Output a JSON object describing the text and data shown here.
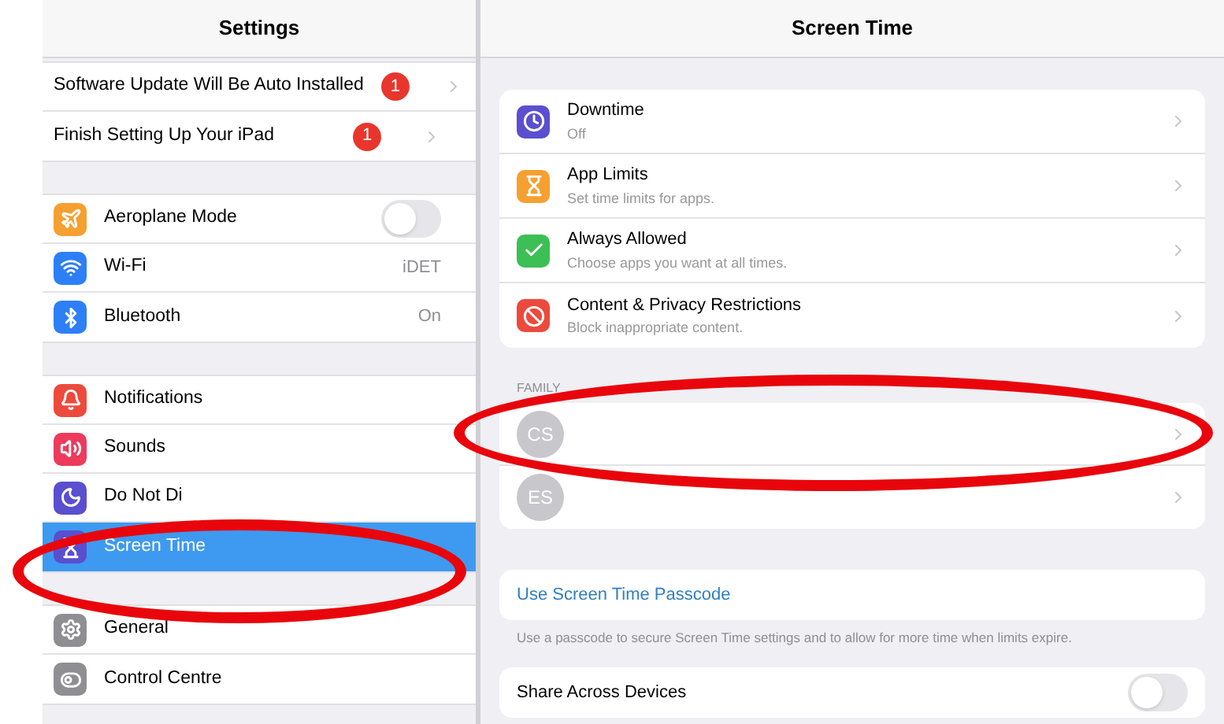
{
  "sidebar": {
    "title": "Settings",
    "groups": [
      {
        "items": [
          {
            "label": "Software Update Will Be Auto Installed",
            "badge": "1",
            "kind": "badge",
            "selected": false
          },
          {
            "label": "Finish Setting Up Your iPad",
            "badge": "1",
            "kind": "badge",
            "selected": false
          }
        ]
      },
      {
        "items": [
          {
            "label": "Aeroplane Mode",
            "kind": "toggle",
            "on": false,
            "selected": false
          },
          {
            "label": "Wi-Fi",
            "kind": "value",
            "value": "iDET",
            "selected": false
          },
          {
            "label": "Bluetooth",
            "kind": "value",
            "value": "On",
            "selected": false
          }
        ]
      },
      {
        "items": [
          {
            "label": "Notifications",
            "kind": "plain",
            "selected": false
          },
          {
            "label": "Sounds",
            "kind": "plain",
            "selected": false
          },
          {
            "label": "Do Not Di",
            "kind": "plain",
            "selected": false
          },
          {
            "label": "Screen Time",
            "kind": "plain",
            "selected": true
          }
        ]
      },
      {
        "items": [
          {
            "label": "General",
            "kind": "plain",
            "selected": false
          },
          {
            "label": "Control Centre",
            "kind": "plain",
            "selected": false
          }
        ]
      }
    ]
  },
  "detail": {
    "title": "Screen Time",
    "features": [
      {
        "title": "Downtime",
        "subtitle": "Off"
      },
      {
        "title": "App Limits",
        "subtitle": "Set time limits for apps."
      },
      {
        "title": "Always Allowed",
        "subtitle": "Choose apps you want at all times."
      },
      {
        "title": "Content & Privacy Restrictions",
        "subtitle": "Block inappropriate content."
      }
    ],
    "family_label": "FAMILY",
    "family": [
      {
        "initials": "CS"
      },
      {
        "initials": "ES"
      }
    ],
    "passcode_link": "Use Screen Time Passcode",
    "passcode_note": "Use a passcode to secure Screen Time settings and to allow for more time when limits expire.",
    "share": {
      "label": "Share Across Devices",
      "on": false
    }
  }
}
